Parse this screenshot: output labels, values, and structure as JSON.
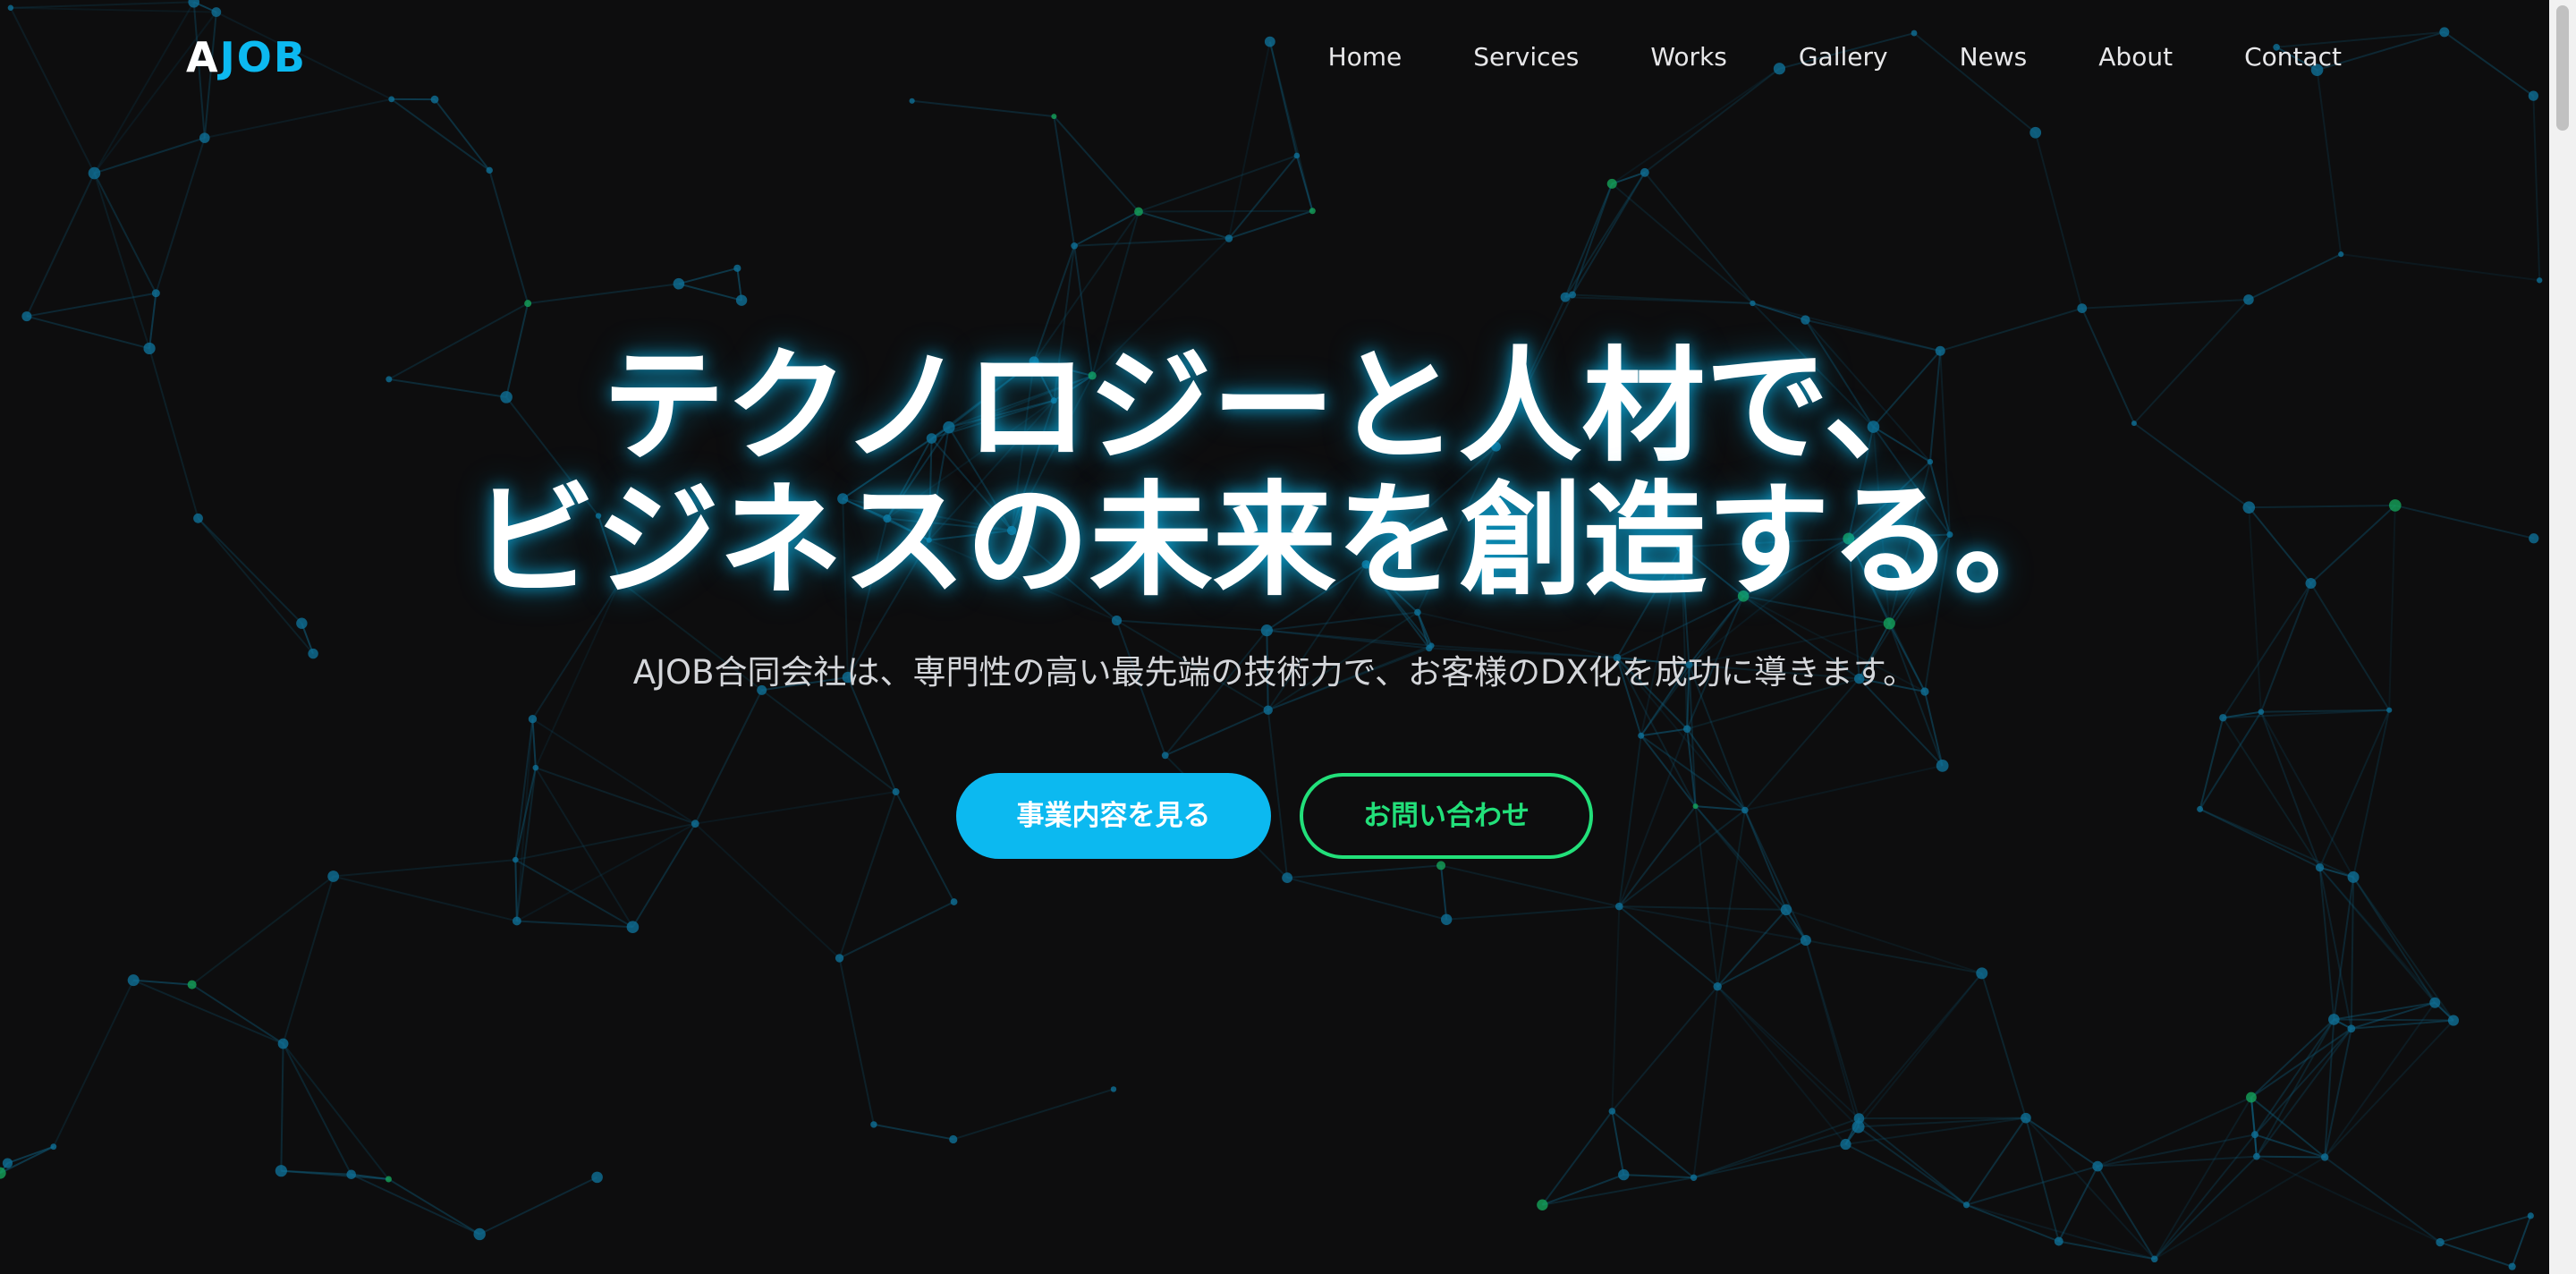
{
  "logo": {
    "first": "A",
    "rest": "JOB"
  },
  "nav": {
    "items": [
      {
        "label": "Home"
      },
      {
        "label": "Services"
      },
      {
        "label": "Works"
      },
      {
        "label": "Gallery"
      },
      {
        "label": "News"
      },
      {
        "label": "About"
      },
      {
        "label": "Contact"
      }
    ]
  },
  "hero": {
    "headline_line1": "テクノロジーと人材で、",
    "headline_line2": "ビジネスの未来を創造する。",
    "lead": "AJOB合同会社は、専門性の高い最先端の技術力で、お客様のDX化を成功に導きます。",
    "primary_button": "事業内容を見る",
    "secondary_button": "お問い合わせ"
  },
  "colors": {
    "accent": "#0cb9f0",
    "secondary_accent": "#22e07a",
    "background": "#0d0d0e"
  }
}
